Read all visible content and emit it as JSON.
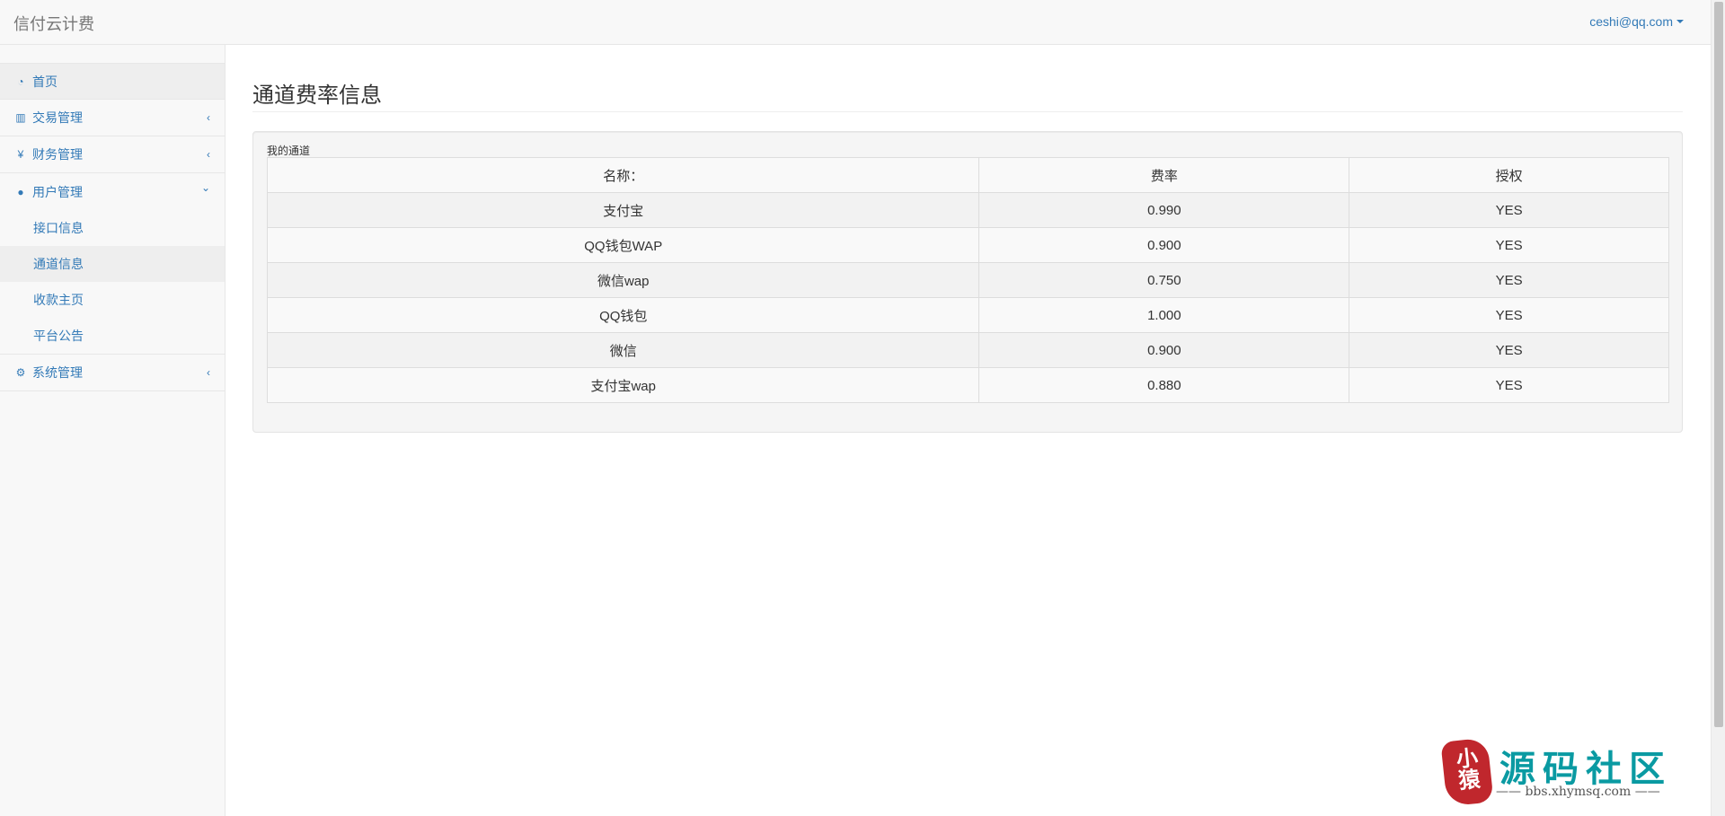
{
  "navbar": {
    "brand": "信付云计费",
    "user": "ceshi@qq.com"
  },
  "sidebar": {
    "items": [
      {
        "label": "首页",
        "icon": "dashboard-icon"
      },
      {
        "label": "交易管理",
        "icon": "bar-chart-icon"
      },
      {
        "label": "财务管理",
        "icon": "yen-icon"
      },
      {
        "label": "用户管理",
        "icon": "user-icon"
      },
      {
        "label": "系统管理",
        "icon": "gears-icon"
      }
    ],
    "submenu": [
      {
        "label": "接口信息"
      },
      {
        "label": "通道信息"
      },
      {
        "label": "收款主页"
      },
      {
        "label": "平台公告"
      }
    ],
    "icon_glyphs": {
      "dashboard": "◔",
      "bar_chart": "▥",
      "yen": "¥",
      "user": "●",
      "gears": "⚙",
      "chevron_left": "‹",
      "chevron_down": "⌄"
    }
  },
  "main": {
    "title": "通道费率信息",
    "panel_legend": "我的通道",
    "table": {
      "headers": [
        "名称：",
        "费率",
        "授权"
      ],
      "rows": [
        [
          "支付宝",
          "0.990",
          "YES"
        ],
        [
          "QQ钱包WAP",
          "0.900",
          "YES"
        ],
        [
          "微信wap",
          "0.750",
          "YES"
        ],
        [
          "QQ钱包",
          "1.000",
          "YES"
        ],
        [
          "微信",
          "0.900",
          "YES"
        ],
        [
          "支付宝wap",
          "0.880",
          "YES"
        ]
      ]
    }
  },
  "watermark": {
    "seal": "小猿",
    "title": "源码社区",
    "sub": "—— bbs.xhymsq.com ——"
  },
  "colors": {
    "link": "#337ab7",
    "navbar_bg": "#f8f8f8",
    "active_bg": "#eeeeee",
    "watermark_teal": "#0a9aa2",
    "seal_red": "#c0272d"
  }
}
